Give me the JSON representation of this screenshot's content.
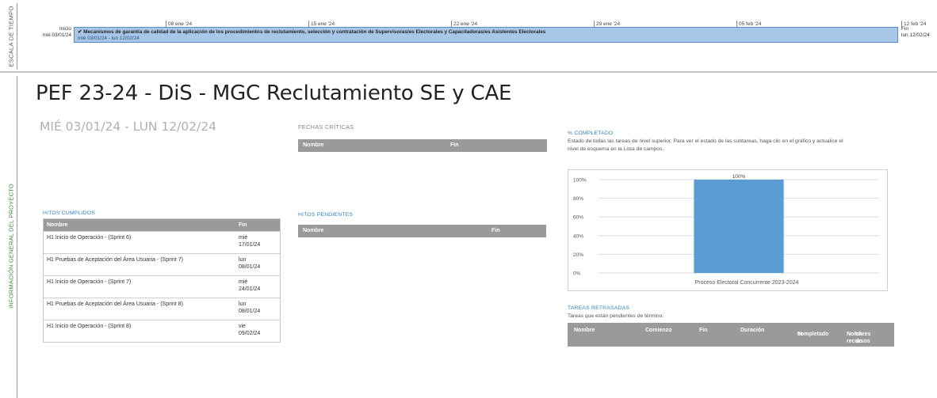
{
  "timeline": {
    "strip_label": "ESCALA DE TIEMPO",
    "ticks": [
      "08 ene '24",
      "15 ene '24",
      "22 ene '24",
      "29 ene '24",
      "05 feb '24",
      "12 feb '24"
    ],
    "start_label": "Inicio",
    "start_date": "mié 03/01/24",
    "task_name": "Mecanismos de garantía de calidad de la aplicación de los procedimientos de reclutamiento, selección y contratación de Supervisoras/es Electorales y Capacitadoras/es Asistentes Electorales",
    "task_dates": "mié 03/01/24 - lun 12/02/24",
    "end_label": "Fin",
    "end_date": "lun 12/02/24"
  },
  "overview": {
    "strip_label": "INFORMACIÓN GENERAL DEL PROYECTO"
  },
  "report": {
    "title": "PEF 23-24 - DiS - MGC Reclutamiento SE y CAE",
    "date_range": "MIÉ 03/01/24 -  LUN 12/02/24"
  },
  "fechas_criticas": {
    "heading": "FECHAS CRÍTICAS",
    "col_name": "Nombre",
    "col_end": "Fin"
  },
  "hitos_cumplidos": {
    "heading": "HITOS CUMPLIDOS",
    "col_name": "Nombre",
    "col_end": "Fin",
    "rows": [
      {
        "name": "H1 Inicio de Operación - (Sprint 6)",
        "day": "mié",
        "date": "17/01/24"
      },
      {
        "name": "H1 Pruebas de Aceptación del Área Usuaria - (Sprint 7)",
        "day": "lun",
        "date": "08/01/24"
      },
      {
        "name": "H1 Inicio de Operación - (Sprint 7)",
        "day": "mié",
        "date": "24/01/24"
      },
      {
        "name": "H1 Pruebas de Aceptación del Área Usuaria - (Sprint 8)",
        "day": "lun",
        "date": "08/01/24"
      },
      {
        "name": "H1 Inicio de Operación - (Sprint 8)",
        "day": "vie",
        "date": "09/02/24"
      }
    ]
  },
  "hitos_pendientes": {
    "heading": "HITOS PENDIENTES",
    "col_name": "Nombre",
    "col_end": "Fin"
  },
  "pct_completado": {
    "heading": "% COMPLETADO",
    "description": "Estado de todas las tareas de nivel superior. Para ver el estado de las subtareas, haga clic en el gráfico y actualice el nivel de esquema en la Lista de campos."
  },
  "chart_data": {
    "type": "bar",
    "categories": [
      "Proceso Electoral Concurrente 2023-2024"
    ],
    "values": [
      100
    ],
    "data_labels": [
      "100%"
    ],
    "yticks": [
      "0%",
      "20%",
      "40%",
      "60%",
      "80%",
      "100%"
    ],
    "ylim": [
      0,
      100
    ],
    "grid": true,
    "bar_color": "#5b9bd5"
  },
  "tareas_retrasadas": {
    "heading": "TAREAS RETRASADAS",
    "description": "Tareas que están pendientes de término.",
    "col_name": "Nombre",
    "col_start": "Comienzo",
    "col_end": "Fin",
    "col_duration": "Duración",
    "col_pct_1": "%",
    "col_pct_2": "completado",
    "col_resources_1": "Nombres de",
    "col_resources_2": "los recursos"
  }
}
